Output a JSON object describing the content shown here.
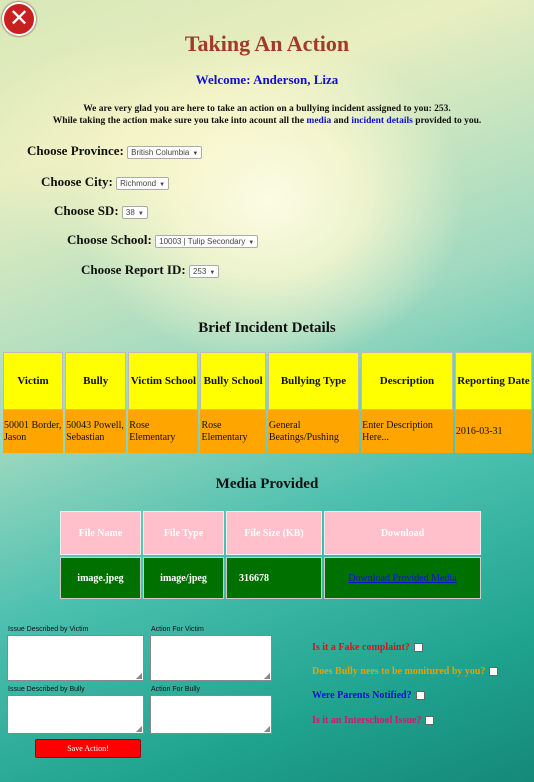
{
  "close_icon": "close-icon",
  "page": {
    "title": "Taking An Action",
    "welcome": "Welcome: Anderson, Liza",
    "intro_line1": "We are very glad you are here to take an action on a bullying incident assigned to you: 253.",
    "intro_line2_a": "While taking the action make sure you take into acount all the ",
    "intro_link_media": "media",
    "intro_line2_b": " and ",
    "intro_link_details": "incident details",
    "intro_line2_c": " provided to you."
  },
  "filters": {
    "province": {
      "label": "Choose Province:",
      "value": "British Columbia"
    },
    "city": {
      "label": "Choose City:",
      "value": "Richmond"
    },
    "sd": {
      "label": "Choose SD:",
      "value": "38"
    },
    "school": {
      "label": "Choose School:",
      "value": "10003 | Tulip Secondary"
    },
    "report": {
      "label": "Choose Report ID:",
      "value": "253"
    }
  },
  "incident": {
    "heading": "Brief Incident Details",
    "columns": [
      "Victim",
      "Bully",
      "Victim School",
      "Bully School",
      "Bullying Type",
      "Description",
      "Reporting Date"
    ],
    "row": [
      "50001 Border, Jason",
      "50043 Powell, Sebastian",
      "Rose Elementary",
      "Rose Elementary",
      "General Beatings/Pushing",
      "Enter Description Here...",
      "2016-03-31"
    ]
  },
  "media": {
    "heading": "Media Provided",
    "columns": [
      "File Name",
      "File Type",
      "File Size (KB)",
      "Download"
    ],
    "row": {
      "file_name": "image.jpeg",
      "file_type": "image/jpeg",
      "file_size": "316678",
      "download": "Download Provided Media"
    }
  },
  "actions": {
    "issue_victim_label": "Issue Described by Victim",
    "action_victim_label": "Action For Victim",
    "issue_bully_label": "Issue Described by Bully",
    "action_bully_label": "Action For Bully",
    "save_label": "Save Action!"
  },
  "questions": [
    {
      "text": "Is it a Fake complaint?",
      "color": "#d01818"
    },
    {
      "text": "Does Bully nees to be monitured by you?",
      "color": "#e8a000"
    },
    {
      "text": "Were Parents Notified?",
      "color": "#1010d0"
    },
    {
      "text": "Is it an Interschool Issue?",
      "color": "#d0186a"
    }
  ]
}
